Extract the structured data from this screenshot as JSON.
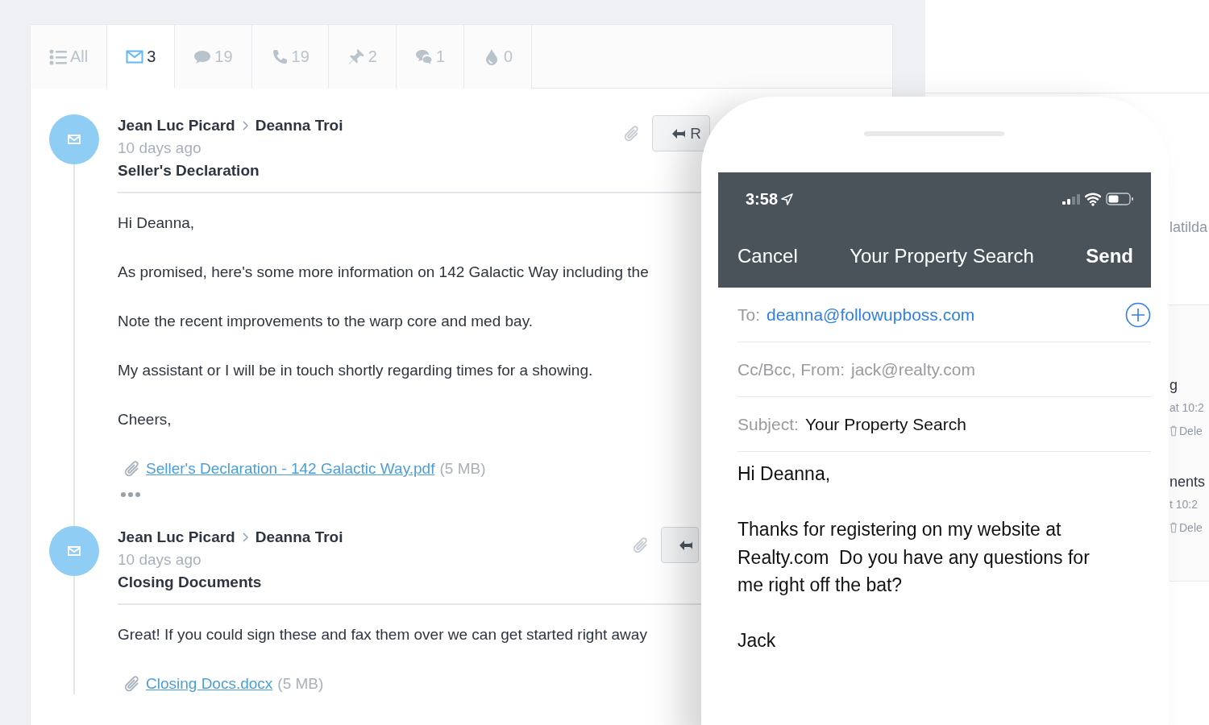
{
  "tabs": [
    {
      "kind": "all",
      "label": "All",
      "selected": false
    },
    {
      "kind": "email",
      "label": "3",
      "selected": true
    },
    {
      "kind": "text",
      "label": "19",
      "selected": false
    },
    {
      "kind": "call",
      "label": "19",
      "selected": false
    },
    {
      "kind": "note",
      "label": "2",
      "selected": false
    },
    {
      "kind": "chat",
      "label": "1",
      "selected": false
    },
    {
      "kind": "drip",
      "label": "0",
      "selected": false
    }
  ],
  "messages": [
    {
      "from": "Jean Luc Picard",
      "to": "Deanna Troi",
      "time": "10 days ago",
      "subject": "Seller's Declaration",
      "reply_label": "R",
      "paragraphs": [
        "Hi Deanna,",
        "As promised, here's some more information on 142 Galactic Way including the",
        "Note the recent improvements to the warp core and med bay.",
        "My assistant or I will be in touch shortly regarding times for a showing.",
        "Cheers,"
      ],
      "attachment": {
        "name": "Seller's Declaration - 142 Galactic Way.pdf",
        "size": "(5 MB)"
      },
      "truncated": true
    },
    {
      "from": "Jean Luc Picard",
      "to": "Deanna Troi",
      "time": "10 days ago",
      "subject": "Closing Documents",
      "paragraphs": [
        "Great! If you could sign these and fax them over we can get started right away"
      ],
      "attachment": {
        "name": "Closing Docs.docx",
        "size": "(5 MB)"
      },
      "truncated": false
    }
  ],
  "background_panel": {
    "label": "latilda",
    "entries": [
      {
        "title": "g",
        "time": "at 10:2",
        "action": "Dele"
      },
      {
        "title": "nents",
        "time": "t 10:2",
        "action": "Dele"
      }
    ]
  },
  "phone": {
    "time": "3:58",
    "nav": {
      "cancel": "Cancel",
      "title": "Your Property Search",
      "send": "Send"
    },
    "fields": [
      {
        "kind": "recipient",
        "label": "To:",
        "value": "deanna@followupboss.com"
      },
      {
        "kind": "sender",
        "label": "Cc/Bcc, From:",
        "value": "jack@realty.com"
      },
      {
        "kind": "subject",
        "label": "Subject:",
        "value": "Your Property Search"
      }
    ],
    "body": [
      "Hi Deanna,",
      "Thanks for registering on my website at Realty.com  Do you have any questions for me right off the bat?",
      "Jack"
    ]
  }
}
